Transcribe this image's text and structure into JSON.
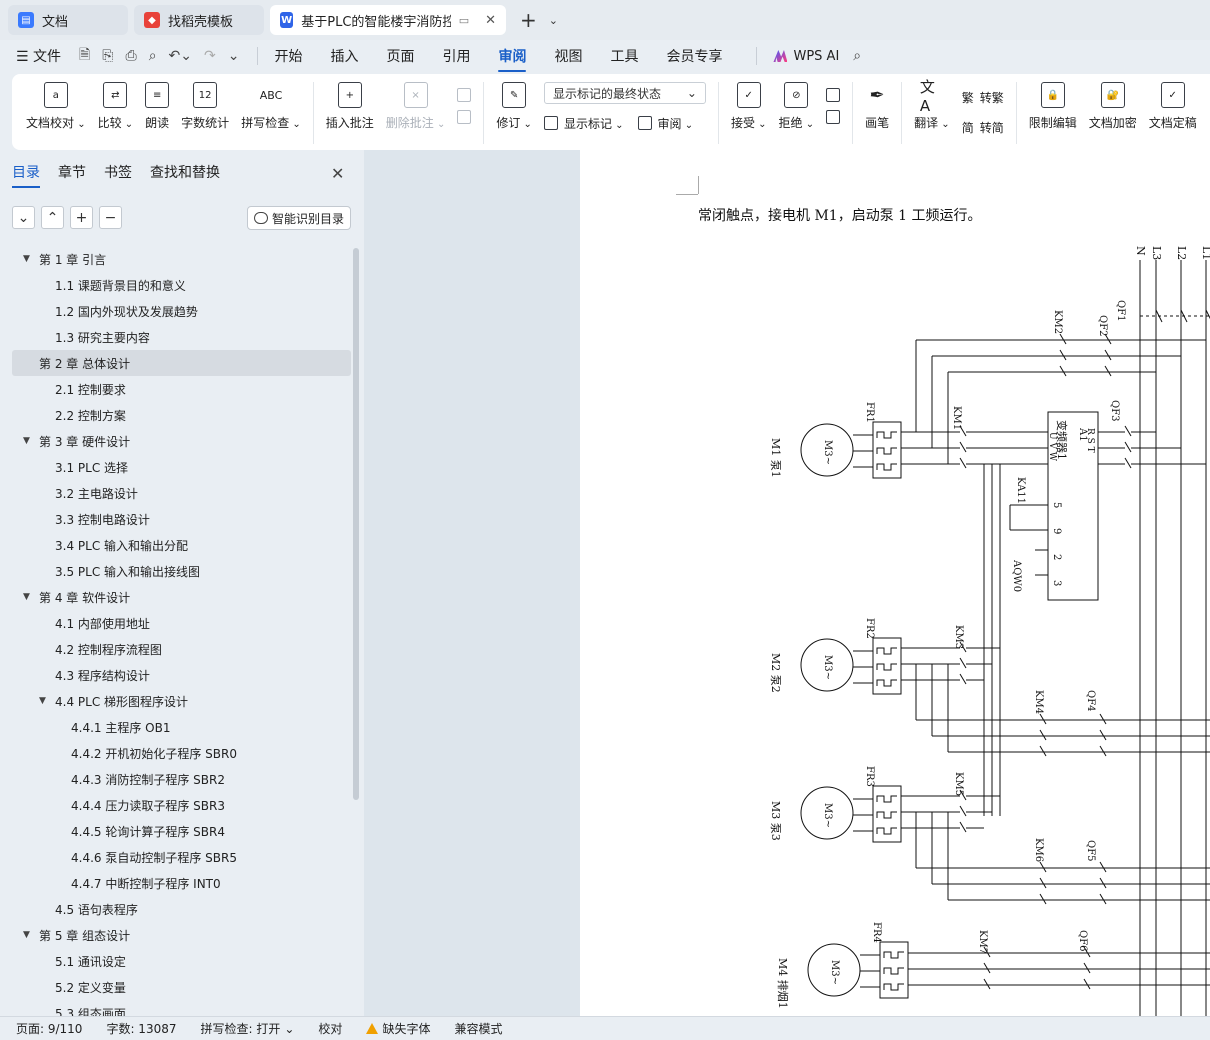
{
  "tabs": [
    {
      "title": "文档",
      "icon": "docs-icon",
      "color": "#3a7afe"
    },
    {
      "title": "找稻壳模板",
      "icon": "docer-icon",
      "color": "#e8423a"
    },
    {
      "title": "基于PLC的智能楼宇消防控制系",
      "icon": "word-icon",
      "color": "#2f64e8",
      "active": true
    }
  ],
  "menu": {
    "file": "文件",
    "items": [
      "开始",
      "插入",
      "页面",
      "引用",
      "审阅",
      "视图",
      "工具",
      "会员专享"
    ],
    "active": "审阅",
    "wps_ai": "WPS AI"
  },
  "ribbon": {
    "proofread": "文档校对",
    "compare": "比较",
    "read_aloud": "朗读",
    "word_count": "字数统计",
    "spell_check": "拼写检查",
    "insert_comment": "插入批注",
    "delete_comment": "删除批注",
    "revise": "修订",
    "markup_state": "显示标记的最终状态",
    "show_markup": "显示标记",
    "review": "审阅",
    "accept": "接受",
    "reject": "拒绝",
    "pen": "画笔",
    "translate": "翻译",
    "to_traditional": "转繁",
    "to_simplified": "转简",
    "restrict_edit": "限制编辑",
    "encrypt": "文档加密",
    "finalize": "文档定稿"
  },
  "left_panel": {
    "tabs": [
      "目录",
      "章节",
      "书签",
      "查找和替换"
    ],
    "active_tab": "目录",
    "smart_toc": "智能识别目录",
    "toc": [
      {
        "text": "第 1 章   引言",
        "level": 1,
        "expanded": true
      },
      {
        "text": "1.1   课题背景目的和意义",
        "level": 2
      },
      {
        "text": "1.2  国内外现状及发展趋势",
        "level": 2
      },
      {
        "text": "1.3  研究主要内容",
        "level": 2
      },
      {
        "text": "第 2 章    总体设计",
        "level": 1,
        "selected": true
      },
      {
        "text": "2.1   控制要求",
        "level": 2
      },
      {
        "text": "2.2   控制方案",
        "level": 2
      },
      {
        "text": "第 3 章    硬件设计",
        "level": 1,
        "expanded": true
      },
      {
        "text": "3.1   PLC 选择",
        "level": 2
      },
      {
        "text": "3.2   主电路设计",
        "level": 2
      },
      {
        "text": "3.3   控制电路设计",
        "level": 2
      },
      {
        "text": "3.4   PLC 输入和输出分配",
        "level": 2
      },
      {
        "text": "3.5   PLC 输入和输出接线图",
        "level": 2
      },
      {
        "text": "第 4 章    软件设计",
        "level": 1,
        "expanded": true
      },
      {
        "text": "4.1   内部使用地址",
        "level": 2
      },
      {
        "text": "4.2   控制程序流程图",
        "level": 2
      },
      {
        "text": "4.3   程序结构设计",
        "level": 2
      },
      {
        "text": "4.4   PLC 梯形图程序设计",
        "level": 2,
        "expanded": true
      },
      {
        "text": "4.4.1  主程序 OB1",
        "level": 3
      },
      {
        "text": "4.4.2  开机初始化子程序 SBR0",
        "level": 3
      },
      {
        "text": "4.4.3 消防控制子程序 SBR2",
        "level": 3
      },
      {
        "text": "4.4.4  压力读取子程序 SBR3",
        "level": 3
      },
      {
        "text": "4.4.5  轮询计算子程序 SBR4",
        "level": 3
      },
      {
        "text": "4.4.6    泵自动控制子程序 SBR5",
        "level": 3
      },
      {
        "text": "4.4.7    中断控制子程序 INT0",
        "level": 3
      },
      {
        "text": "4.5   语句表程序",
        "level": 2
      },
      {
        "text": "第 5 章  组态设计",
        "level": 1,
        "expanded": true
      },
      {
        "text": "5.1   通讯设定",
        "level": 2
      },
      {
        "text": "5.2   定义变量",
        "level": 2
      },
      {
        "text": "5.3   组态画面",
        "level": 2
      }
    ]
  },
  "document": {
    "paragraph": "常闭触点，接电机 M1，启动泵 1 工频运行。",
    "diagram": {
      "bus_labels": [
        "N",
        "L3",
        "L2",
        "L1"
      ],
      "breakers": [
        "QF1",
        "QF2",
        "QF3",
        "QF4",
        "QF5",
        "QF6"
      ],
      "contactors": [
        "KM1",
        "KM2",
        "KM3",
        "KM4",
        "KM5",
        "KM6",
        "KM7"
      ],
      "relays": [
        "FR1",
        "FR2",
        "FR3",
        "FR4"
      ],
      "motor_label": "M3~",
      "pumps": [
        "M1 泵1",
        "M2 泵2",
        "M3 泵3",
        "M4 排烟1"
      ],
      "vfd": {
        "name": "变频器1",
        "id": "A1",
        "inputs": "R S T",
        "outputs": "U V W",
        "terminals": [
          "5",
          "9",
          "2",
          "3"
        ],
        "relay": "KA11",
        "analog": "AQW0"
      }
    }
  },
  "status": {
    "page": "页面: 9/110",
    "words": "字数: 13087",
    "spell": "拼写检查: 打开",
    "proof": "校对",
    "missing_font": "缺失字体",
    "compat": "兼容模式"
  }
}
